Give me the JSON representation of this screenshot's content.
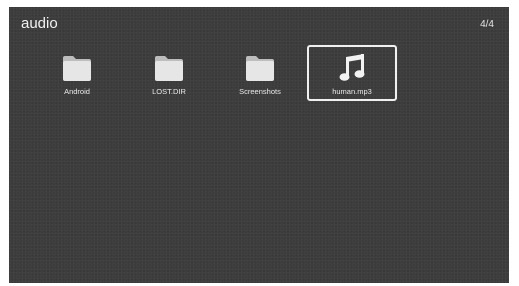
{
  "header": {
    "title": "audio",
    "page_counter": "4/4"
  },
  "items": [
    {
      "label": "Android",
      "icon": "folder-icon",
      "selected": false
    },
    {
      "label": "LOST.DIR",
      "icon": "folder-icon",
      "selected": false
    },
    {
      "label": "Screenshots",
      "icon": "folder-icon",
      "selected": false
    },
    {
      "label": "human.mp3",
      "icon": "music-note-icon",
      "selected": true
    }
  ],
  "colors": {
    "background": "#3c3c3c",
    "folder_front": "#e6e6e6",
    "folder_back": "#bdbdbd",
    "selection_border": "#f0f0f0"
  }
}
